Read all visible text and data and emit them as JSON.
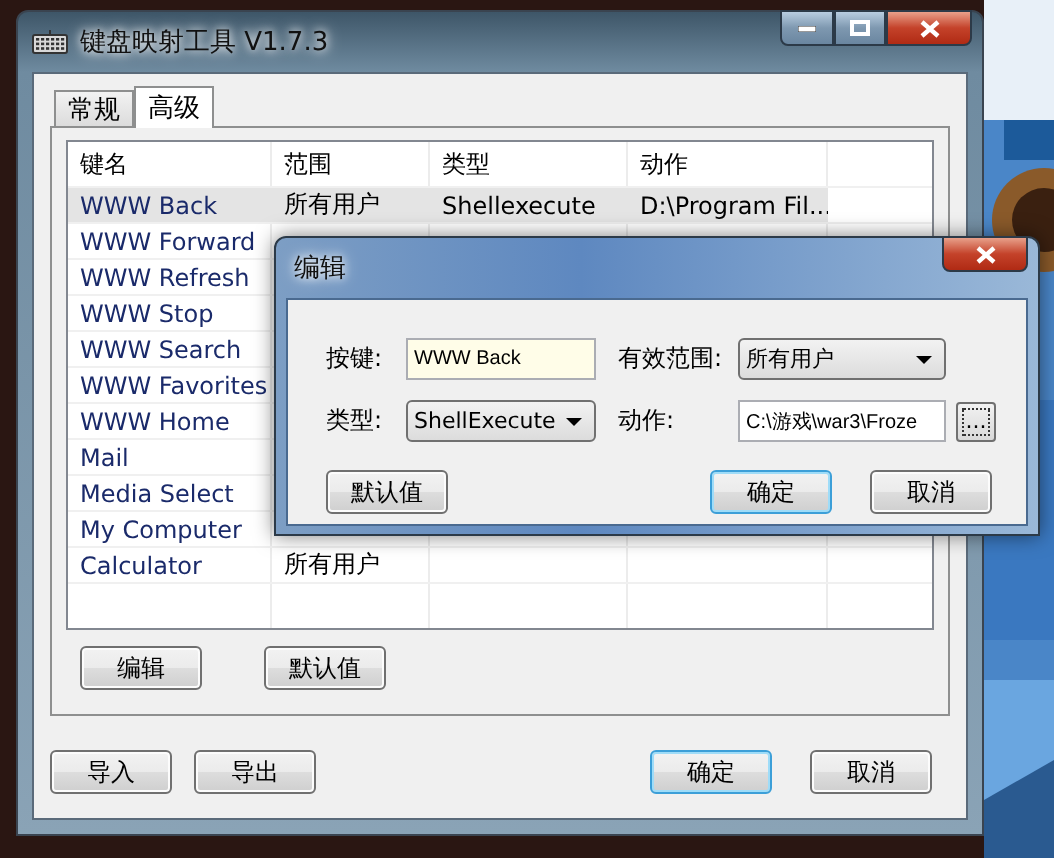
{
  "window": {
    "title": "键盘映射工具 V1.7.3"
  },
  "tabs": [
    {
      "label": "常规",
      "selected": false
    },
    {
      "label": "高级",
      "selected": true
    }
  ],
  "table": {
    "columns": [
      "键名",
      "范围",
      "类型",
      "动作"
    ],
    "rows": [
      {
        "cells": [
          "WWW Back",
          "所有用户",
          "Shellexecute",
          "D:\\Program Fil..."
        ],
        "selected": true
      },
      {
        "cells": [
          "WWW Forward"
        ],
        "selected": false
      },
      {
        "cells": [
          "WWW Refresh"
        ],
        "selected": false
      },
      {
        "cells": [
          "WWW Stop"
        ],
        "selected": false
      },
      {
        "cells": [
          "WWW Search"
        ],
        "selected": false
      },
      {
        "cells": [
          "WWW Favorites"
        ],
        "selected": false
      },
      {
        "cells": [
          "WWW Home"
        ],
        "selected": false
      },
      {
        "cells": [
          "Mail"
        ],
        "selected": false
      },
      {
        "cells": [
          "Media Select"
        ],
        "selected": false
      },
      {
        "cells": [
          "My Computer"
        ],
        "selected": false
      },
      {
        "cells": [
          "Calculator",
          "所有用户"
        ],
        "selected": false
      }
    ]
  },
  "panel_buttons": [
    "编辑",
    "默认值"
  ],
  "footer_buttons": [
    {
      "label": "导入",
      "default": false
    },
    {
      "label": "导出",
      "default": false
    },
    {
      "label": "确定",
      "default": true
    },
    {
      "label": "取消",
      "default": false
    }
  ],
  "dialog": {
    "title": "编辑",
    "key_label": "按键:",
    "key_value": "WWW Back",
    "scope_label": "有效范围:",
    "scope_value": "所有用户",
    "type_label": "类型:",
    "type_value": "ShellExecute",
    "action_label": "动作:",
    "action_value": "C:\\游戏\\war3\\Froze",
    "browse": "...",
    "buttons": [
      {
        "label": "默认值",
        "default": false
      },
      {
        "label": "确定",
        "default": true
      },
      {
        "label": "取消",
        "default": false
      }
    ]
  }
}
